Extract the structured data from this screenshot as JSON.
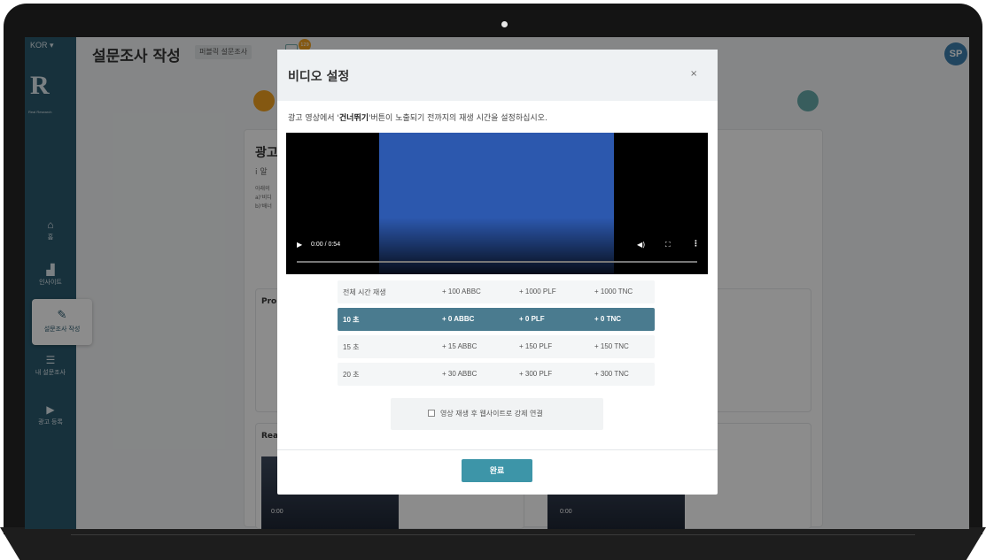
{
  "app": {
    "language": "KOR ▾",
    "logo_text": "R",
    "logo_subtext": "Real Research",
    "page_title": "설문조사 작성",
    "survey_type": "퍼블릭 설문조사",
    "notification_count": "129",
    "avatar_initials": "SP"
  },
  "sidebar": {
    "items": [
      {
        "label": "홈",
        "icon": "home-icon"
      },
      {
        "label": "인사이트",
        "icon": "chart-icon"
      },
      {
        "label": "설문조사 작성",
        "icon": "pencil-icon",
        "active": true
      },
      {
        "label": "내 설문조사",
        "icon": "list-icon"
      },
      {
        "label": "광고 등록",
        "icon": "play-icon"
      }
    ]
  },
  "background": {
    "card_title": "광고",
    "card_info": "i 알",
    "lines": [
      "아래의",
      "a)'비디",
      "b)'배너"
    ],
    "panel1_title": "Pror",
    "panel2_title": "Rea",
    "video_time": "0:00"
  },
  "modal": {
    "title": "비디오 설정",
    "close_label": "×",
    "desc_before": "광고 영상에서 '",
    "desc_bold": "건너뛰기",
    "desc_after": "'버튼이 노출되기 전까지의 재생 시간을 설정하십시오.",
    "video": {
      "time": "0:00 / 0:54",
      "progress": 0
    },
    "options": [
      {
        "label": "전체 시간 재생",
        "abbc": "+ 100 ABBC",
        "plf": "+ 1000 PLF",
        "tnc": "+ 1000 TNC",
        "selected": false
      },
      {
        "label": "10 초",
        "abbc": "+ 0 ABBC",
        "plf": "+ 0 PLF",
        "tnc": "+ 0 TNC",
        "selected": true
      },
      {
        "label": "15 초",
        "abbc": "+ 15 ABBC",
        "plf": "+ 150 PLF",
        "tnc": "+ 150 TNC",
        "selected": false
      },
      {
        "label": "20 초",
        "abbc": "+ 30 ABBC",
        "plf": "+ 300 PLF",
        "tnc": "+ 300 TNC",
        "selected": false
      }
    ],
    "checkbox_label": "영상 재생 후 웹사이트로 강제 연결",
    "checkbox_checked": false,
    "done_label": "완료"
  },
  "colors": {
    "sidebar": "#2a5a6e",
    "selected_row": "#4a7b8f",
    "done_button": "#3d95a8",
    "video_blue": "#2c58ae",
    "avatar": "#3d7fae"
  }
}
